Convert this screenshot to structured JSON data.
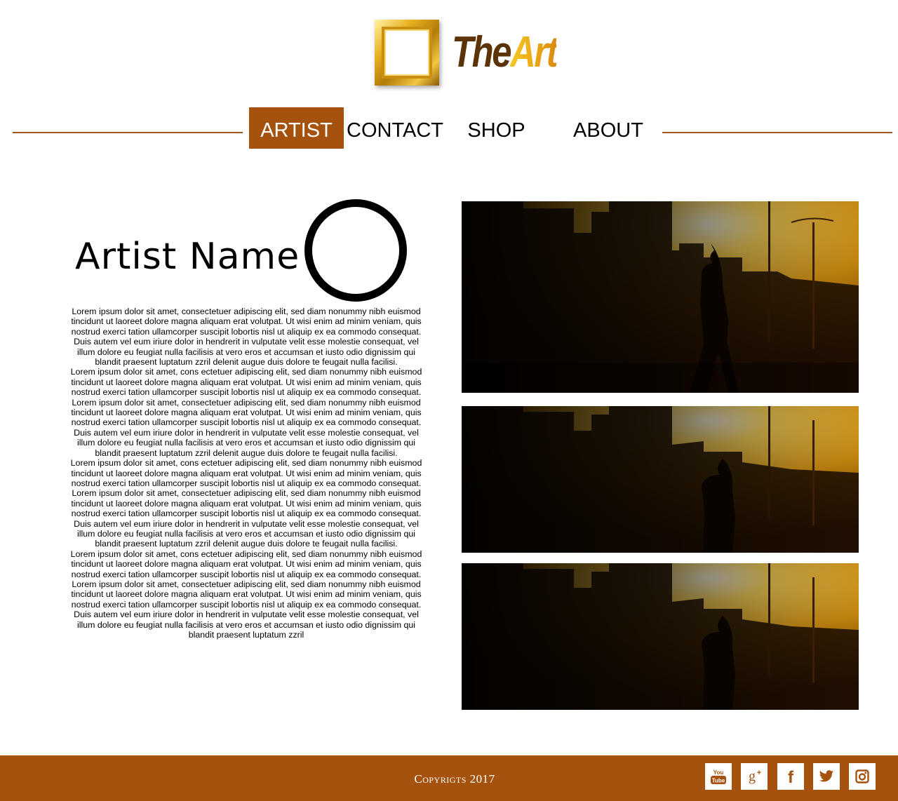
{
  "brand": {
    "the": "The",
    "art": "Art"
  },
  "nav": {
    "items": [
      {
        "label": "ARTIST",
        "active": true
      },
      {
        "label": "CONTACT",
        "active": false
      },
      {
        "label": "SHOP",
        "active": false
      },
      {
        "label": "ABOUT",
        "active": false
      }
    ]
  },
  "artist": {
    "name": "Artist Name",
    "bio": [
      "Lorem ipsum dolor sit amet, consectetuer adipiscing elit, sed diam nonummy nibh euismod tincidunt ut laoreet dolore magna aliquam erat volutpat. Ut wisi enim ad minim veniam, quis nostrud exerci tation ullamcorper suscipit lobortis nisl ut aliquip ex ea commodo consequat. Duis autem vel eum iriure dolor in hendrerit in vulputate velit esse molestie consequat, vel illum dolore eu feugiat nulla facilisis at vero eros et accumsan et iusto odio dignissim qui blandit praesent luptatum zzril delenit augue duis dolore te feugait nulla facilisi.",
      "Lorem ipsum dolor sit amet, cons ectetuer adipiscing elit, sed diam nonummy nibh euismod tincidunt ut laoreet dolore magna aliquam erat volutpat. Ut wisi enim ad minim veniam, quis nostrud exerci tation ullamcorper suscipit lobortis nisl ut aliquip ex ea commodo consequat.",
      "Lorem ipsum dolor sit amet, consectetuer adipiscing elit, sed diam nonummy nibh euismod tincidunt ut laoreet dolore magna aliquam erat volutpat. Ut wisi enim ad minim veniam, quis nostrud exerci tation ullamcorper suscipit lobortis nisl ut aliquip ex ea commodo consequat. Duis autem vel eum iriure dolor in hendrerit in vulputate velit esse molestie consequat, vel illum dolore eu feugiat nulla facilisis at vero eros et accumsan et iusto odio dignissim qui blandit praesent luptatum zzril delenit augue duis dolore te feugait nulla facilisi.",
      "Lorem ipsum dolor sit amet, cons ectetuer adipiscing elit, sed diam nonummy nibh euismod tincidunt ut laoreet dolore magna aliquam erat volutpat. Ut wisi enim ad minim veniam, quis nostrud exerci tation ullamcorper suscipit lobortis nisl ut aliquip ex ea commodo consequat.",
      "Lorem ipsum dolor sit amet, consectetuer adipiscing elit, sed diam nonummy nibh euismod tincidunt ut laoreet dolore magna aliquam erat volutpat. Ut wisi enim ad minim veniam, quis nostrud exerci tation ullamcorper suscipit lobortis nisl ut aliquip ex ea commodo consequat. Duis autem vel eum iriure dolor in hendrerit in vulputate velit esse molestie consequat, vel illum dolore eu feugiat nulla facilisis at vero eros et accumsan et iusto odio dignissim qui blandit praesent luptatum zzril delenit augue duis dolore te feugait nulla facilisi.",
      "Lorem ipsum dolor sit amet, cons ectetuer adipiscing elit, sed diam nonummy nibh euismod tincidunt ut laoreet dolore magna aliquam erat volutpat. Ut wisi enim ad minim veniam, quis nostrud exerci tation ullamcorper suscipit lobortis nisl ut aliquip ex ea commodo consequat.",
      "Lorem ipsum dolor sit amet, consectetuer adipiscing elit, sed diam nonummy nibh euismod tincidunt ut laoreet dolore magna aliquam erat volutpat. Ut wisi enim ad minim veniam, quis nostrud exerci tation ullamcorper suscipit lobortis nisl ut aliquip ex ea commodo consequat. Duis autem vel eum iriure dolor in hendrerit in vulputate velit esse molestie consequat, vel illum dolore eu feugiat nulla facilisis at vero eros et accumsan et iusto odio dignissim qui blandit praesent luptatum zzril"
    ]
  },
  "footer": {
    "copyright": "Copyrigts 2017",
    "social": [
      {
        "icon": "youtube-icon",
        "text": "You Tube"
      },
      {
        "icon": "google-plus-icon",
        "text": "g+"
      },
      {
        "icon": "facebook-icon",
        "text": "f"
      },
      {
        "icon": "twitter-icon",
        "text": ""
      },
      {
        "icon": "instagram-icon",
        "text": ""
      }
    ]
  },
  "colors": {
    "accent": "#a6520f",
    "brand_dark": "#5c3208",
    "brand_gold": "#e9a414"
  }
}
